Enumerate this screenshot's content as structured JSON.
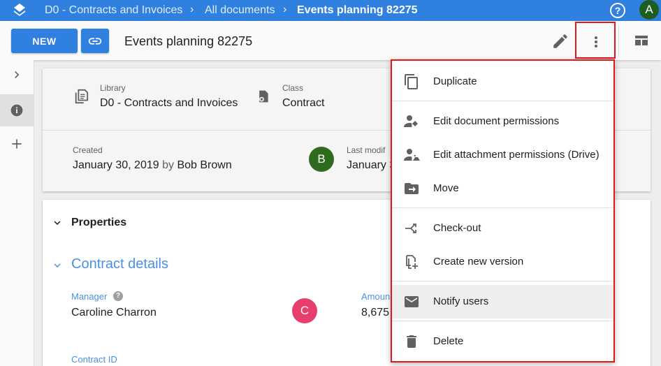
{
  "breadcrumb": {
    "items": [
      "D0 - Contracts and Invoices",
      "All documents"
    ],
    "current": "Events planning 82275"
  },
  "topbar": {
    "help_icon": "help-circle-icon",
    "user_initial": "A"
  },
  "toolbar": {
    "new_label": "NEW",
    "title": "Events planning 82275"
  },
  "info": {
    "library_label": "Library",
    "library_value": "D0 - Contracts and Invoices",
    "class_label": "Class",
    "class_value": "Contract",
    "created_label": "Created",
    "created_date": "January 30, 2019",
    "created_by": "by",
    "created_user": "Bob Brown",
    "creator_initial": "B",
    "modified_label": "Last modif",
    "modified_value": "January 3"
  },
  "properties": {
    "title": "Properties",
    "section": "Contract details",
    "manager_label": "Manager",
    "manager_value": "Caroline Charron",
    "manager_initial": "C",
    "amount_label": "Amoun",
    "amount_value": "8,675",
    "contract_id_label": "Contract ID"
  },
  "menu": {
    "items": [
      {
        "label": "Duplicate",
        "icon": "copy-icon"
      },
      {
        "label": "Edit document permissions",
        "icon": "user-permissions-icon"
      },
      {
        "label": "Edit attachment permissions (Drive)",
        "icon": "drive-permissions-icon"
      },
      {
        "label": "Move",
        "icon": "move-folder-icon"
      },
      {
        "label": "Check-out",
        "icon": "checkout-icon"
      },
      {
        "label": "Create new version",
        "icon": "new-version-icon"
      },
      {
        "label": "Notify users",
        "icon": "mail-icon"
      },
      {
        "label": "Delete",
        "icon": "trash-icon"
      }
    ]
  },
  "colors": {
    "primary": "#2f80df",
    "highlight_border": "#e01818",
    "accent_text": "#4a90e2"
  }
}
